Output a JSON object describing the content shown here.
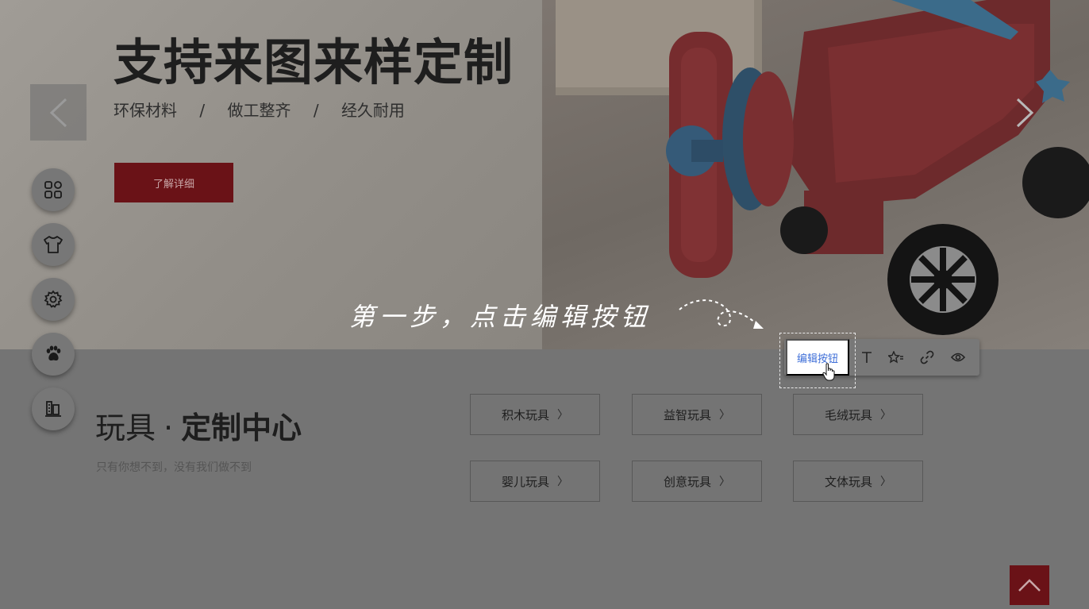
{
  "hero": {
    "title": "支持来图来样定制",
    "subtitle_items": [
      "环保材料",
      "做工整齐",
      "经久耐用"
    ],
    "subtitle_separator": "/",
    "cta_label": "了解详细"
  },
  "sidebar": {
    "items": [
      {
        "icon": "grid-icon"
      },
      {
        "icon": "tshirt-icon"
      },
      {
        "icon": "gear-icon"
      },
      {
        "icon": "paw-icon"
      },
      {
        "icon": "building-icon"
      }
    ]
  },
  "section": {
    "title_light": "玩具",
    "title_dot": "·",
    "title_bold": "定制中心",
    "subtitle": "只有你想不到，没有我们做不到"
  },
  "categories": [
    "积木玩具",
    "益智玩具",
    "毛绒玩具",
    "婴儿玩具",
    "创意玩具",
    "文体玩具"
  ],
  "toolbar": {
    "edit_label": "编辑按钮",
    "tools": [
      "text-icon",
      "star-list-icon",
      "link-icon",
      "eye-icon"
    ]
  },
  "tutorial": {
    "text": "第一步，点击编辑按钮"
  },
  "colors": {
    "brand_red": "#c8202a",
    "edit_blue": "#3f6fd8"
  }
}
